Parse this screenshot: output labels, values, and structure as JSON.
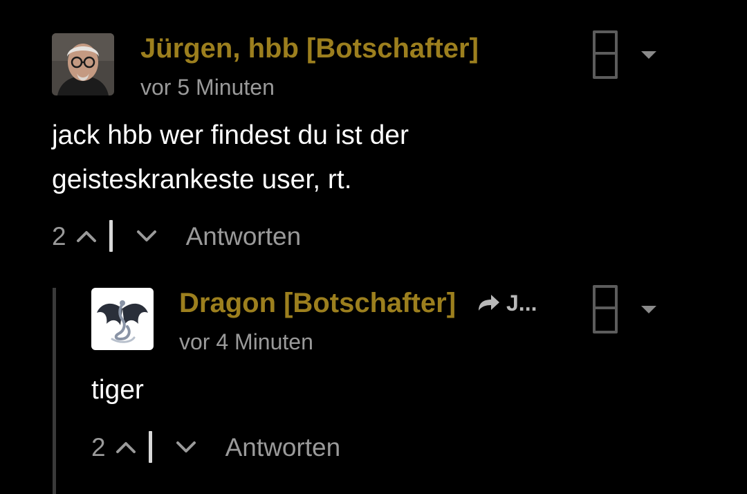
{
  "comments": [
    {
      "author": "Jürgen, hbb [Botschafter]",
      "time": "vor 5 Minuten",
      "body_lines": [
        "jack hbb wer findest du ist der",
        "geisteskrankeste user, rt."
      ],
      "votes": "2",
      "reply_label": "Antworten"
    },
    {
      "author": "Dragon [Botschafter]",
      "reply_to": "J...",
      "time": "vor 4 Minuten",
      "body_lines": [
        "tiger"
      ],
      "votes": "2",
      "reply_label": "Antworten"
    }
  ],
  "colors": {
    "background": "#000000",
    "author": "#9c7f1e",
    "muted": "#9a9a9a",
    "text": "#ffffff"
  },
  "icons": [
    "upvote-icon",
    "downvote-icon",
    "reply-arrow-icon",
    "menu-icon",
    "chevron-down-icon"
  ]
}
